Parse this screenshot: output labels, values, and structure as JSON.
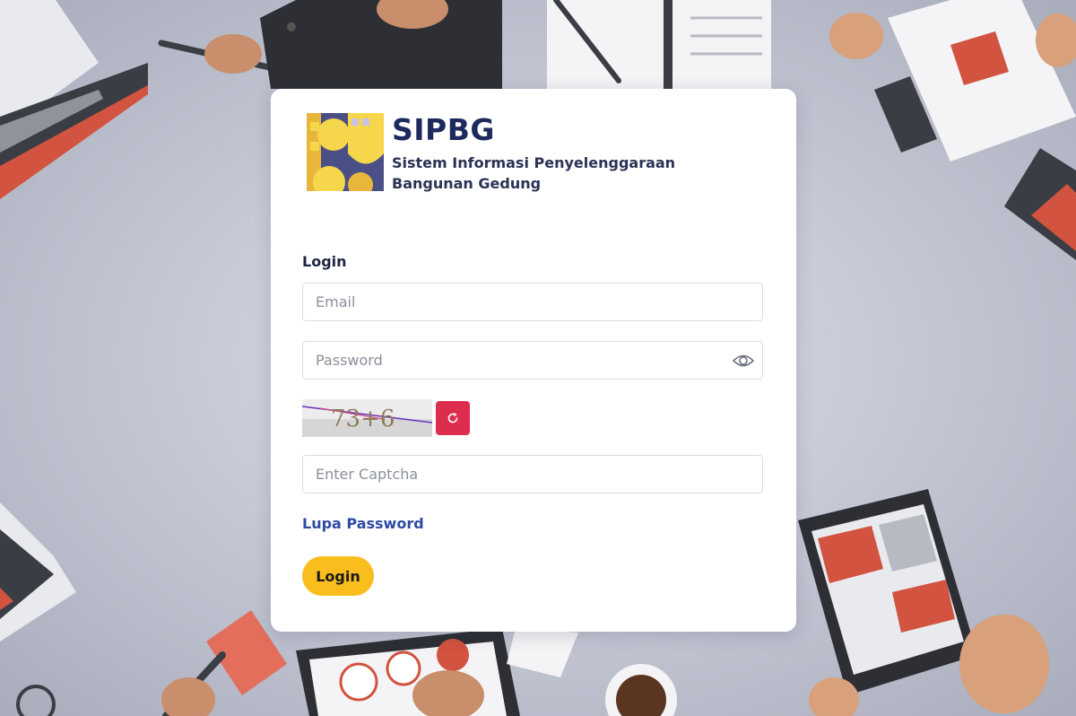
{
  "app": {
    "title": "SIPBG",
    "subtitle": "Sistem Informasi Penyelenggaraan Bangunan Gedung"
  },
  "login": {
    "heading": "Login",
    "email_placeholder": "Email",
    "password_placeholder": "Password",
    "captcha_text": "73+6",
    "captcha_placeholder": "Enter Captcha",
    "forgot_link": "Lupa Password",
    "submit_label": "Login"
  },
  "icons": {
    "password_toggle": "eye-icon",
    "captcha_refresh": "refresh-icon"
  },
  "colors": {
    "brand_navy": "#1e2a5e",
    "login_button": "#f9be1e",
    "refresh_button": "#dc2d4e",
    "link": "#2e4ba3",
    "card": "#ffffff"
  }
}
